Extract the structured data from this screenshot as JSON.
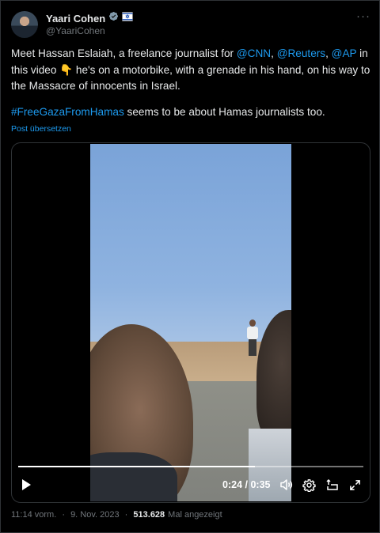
{
  "author": {
    "display_name": "Yaari Cohen",
    "handle": "@YaariCohen",
    "verified_icon": "verified-badge-icon",
    "affiliation_icon": "flag-icon"
  },
  "tweet": {
    "text_parts": {
      "p1_a": "Meet Hassan Eslaiah, a freelance journalist for ",
      "mention_cnn": "@CNN",
      "comma1": ", ",
      "mention_reuters": "@Reuters",
      "comma2": ", ",
      "mention_ap": "@AP",
      "p1_b": " in this video ",
      "emoji": "👇",
      "p1_c": " he's on a motorbike, with a grenade in his hand, on his way to the Massacre of innocents in Israel.",
      "hashtag": "#FreeGazaFromHamas",
      "p2": " seems to be about Hamas journalists too."
    },
    "translate_label": "Post übersetzen"
  },
  "video": {
    "current_time": "0:24",
    "separator": " / ",
    "duration": "0:35",
    "progress_fraction": 0.686
  },
  "meta": {
    "time": "11:14 vorm.",
    "sep1": " · ",
    "date": "9. Nov. 2023",
    "sep2": " · ",
    "views_count": "513.628",
    "views_label": "Mal angezeigt"
  },
  "colors": {
    "accent": "#1d9bf0",
    "background": "#000000",
    "muted": "#71767b"
  }
}
